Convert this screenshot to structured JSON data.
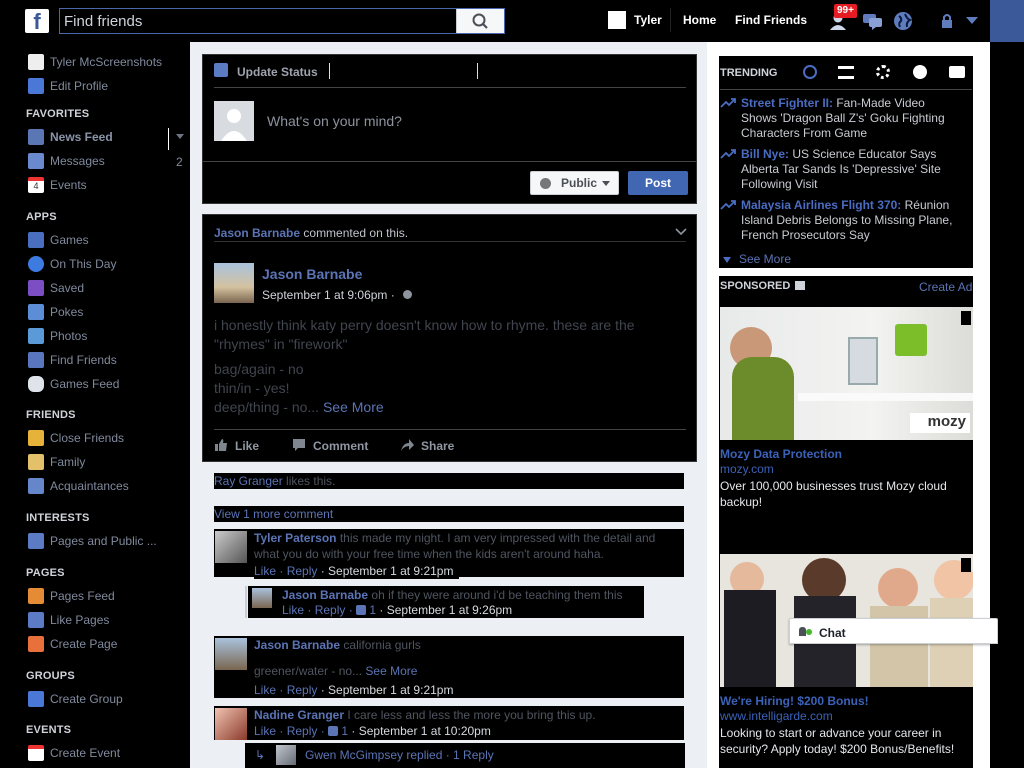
{
  "topbar": {
    "search_placeholder": "Find friends",
    "user_name": "Tyler",
    "home": "Home",
    "find_friends": "Find Friends",
    "friend_requests_badge": "99+"
  },
  "leftnav": {
    "profile_name": "Tyler McScreenshots",
    "edit_profile": "Edit Profile",
    "favorites_head": "FAVORITES",
    "favorites": [
      {
        "label": "News Feed",
        "icon": "news-feed-icon"
      },
      {
        "label": "Messages",
        "icon": "messages-icon",
        "count": "2"
      },
      {
        "label": "Events",
        "icon": "events-icon"
      }
    ],
    "apps_head": "APPS",
    "apps": [
      {
        "label": "Games",
        "icon": "games-icon"
      },
      {
        "label": "On This Day",
        "icon": "on-this-day-icon"
      },
      {
        "label": "Saved",
        "icon": "saved-icon"
      },
      {
        "label": "Pokes",
        "icon": "pokes-icon"
      },
      {
        "label": "Photos",
        "icon": "photos-icon"
      },
      {
        "label": "Find Friends",
        "icon": "find-friends-icon"
      },
      {
        "label": "Games Feed",
        "icon": "games-feed-icon"
      }
    ],
    "friends_head": "FRIENDS",
    "friends": [
      {
        "label": "Close Friends",
        "icon": "close-friends-icon"
      },
      {
        "label": "Family",
        "icon": "family-icon"
      },
      {
        "label": "Acquaintances",
        "icon": "acquaintances-icon"
      }
    ],
    "interests_head": "INTERESTS",
    "interests": [
      {
        "label": "Pages and Public ...",
        "icon": "pages-feed-icon"
      }
    ],
    "pages_head": "PAGES",
    "pages": [
      {
        "label": "Pages Feed",
        "icon": "pages-feed-icon"
      },
      {
        "label": "Like Pages",
        "icon": "like-pages-icon"
      },
      {
        "label": "Create Page",
        "icon": "create-page-icon"
      }
    ],
    "groups_head": "GROUPS",
    "groups": [
      {
        "label": "Create Group",
        "icon": "create-group-icon"
      }
    ],
    "events_head": "EVENTS",
    "events": [
      {
        "label": "Create Event",
        "icon": "create-event-icon"
      }
    ]
  },
  "composer": {
    "tab_label": "Update Status",
    "placeholder": "What's on your mind?",
    "privacy": "Public",
    "post_button": "Post"
  },
  "story": {
    "activity_actor": "Jason Barnabe",
    "activity_text": "commented on this.",
    "author": "Jason Barnabe",
    "timestamp": "September 1 at 9:06pm ·",
    "body_lines": [
      "i honestly think katy perry doesn't know how to rhyme. these are the",
      "\"rhymes\" in \"firework\"",
      "bag/again - no",
      "thin/in - yes!",
      "deep/thing - no..."
    ],
    "see_more": "See More",
    "like": "Like",
    "comment": "Comment",
    "share": "Share",
    "likes_name": "Ray Granger",
    "likes_text": "likes this.",
    "view_more": "View 1 more comment",
    "comments": [
      {
        "author": "Tyler Paterson",
        "text_line1": "this made my night. I am very impressed with the detail and",
        "text_line2": "what you do with your free time when the kids aren't around haha.",
        "like": "Like",
        "reply": "Reply",
        "time": "September 1 at 9:21pm"
      },
      {
        "author": "Jason Barnabe",
        "text_line1": "oh if they were around i'd be teaching them this",
        "like": "Like",
        "reply": "Reply",
        "likes": "1",
        "time": "September 1 at 9:26pm"
      },
      {
        "author": "Jason Barnabe",
        "text_line1": "california gurls",
        "text_line2": "greener/water - no...",
        "see_more": "See More",
        "like": "Like",
        "reply": "Reply",
        "time": "September 1 at 9:21pm"
      },
      {
        "author": "Nadine Granger",
        "text_line1": "I care less and less the more you bring this up.",
        "like": "Like",
        "reply": "Reply",
        "likes": "1",
        "time": "September 1 at 10:20pm"
      }
    ],
    "reply_summary": "Gwen McGimpsey replied · 1 Reply"
  },
  "trending": {
    "head": "TRENDING",
    "items": [
      {
        "topic": "Street Fighter II:",
        "text1": " Fan-Made Video",
        "text2": "Shows 'Dragon Ball Z's' Goku Fighting",
        "text3": "Characters From Game"
      },
      {
        "topic": "Bill Nye:",
        "text1": " US Science Educator Says",
        "text2": "Alberta Tar Sands Is 'Depressive' Site",
        "text3": "Following Visit"
      },
      {
        "topic": "Malaysia Airlines Flight 370:",
        "text1": " Réunion",
        "text2": "Island Debris Belongs to Missing Plane,",
        "text3": "French Prosecutors Say"
      }
    ],
    "see_more": "See More"
  },
  "sponsored": {
    "head": "SPONSORED",
    "create_ad": "Create Ad",
    "ads": [
      {
        "title": "Mozy Data Protection",
        "domain": "mozy.com",
        "text": "Over 100,000 businesses trust Mozy cloud backup!",
        "brand": "mozy"
      },
      {
        "title": "We're Hiring! $200 Bonus!",
        "domain": "www.intelligarde.com",
        "text": "Looking to start or advance your career in security? Apply today! $200 Bonus/Benefits!"
      }
    ]
  },
  "chat": {
    "label": "Chat"
  },
  "colors": {
    "fb_blue": "#3b5998",
    "link_blue": "#5b74b5",
    "badge_red": "#e41b23",
    "trending_blue": "#4a6cc2"
  }
}
